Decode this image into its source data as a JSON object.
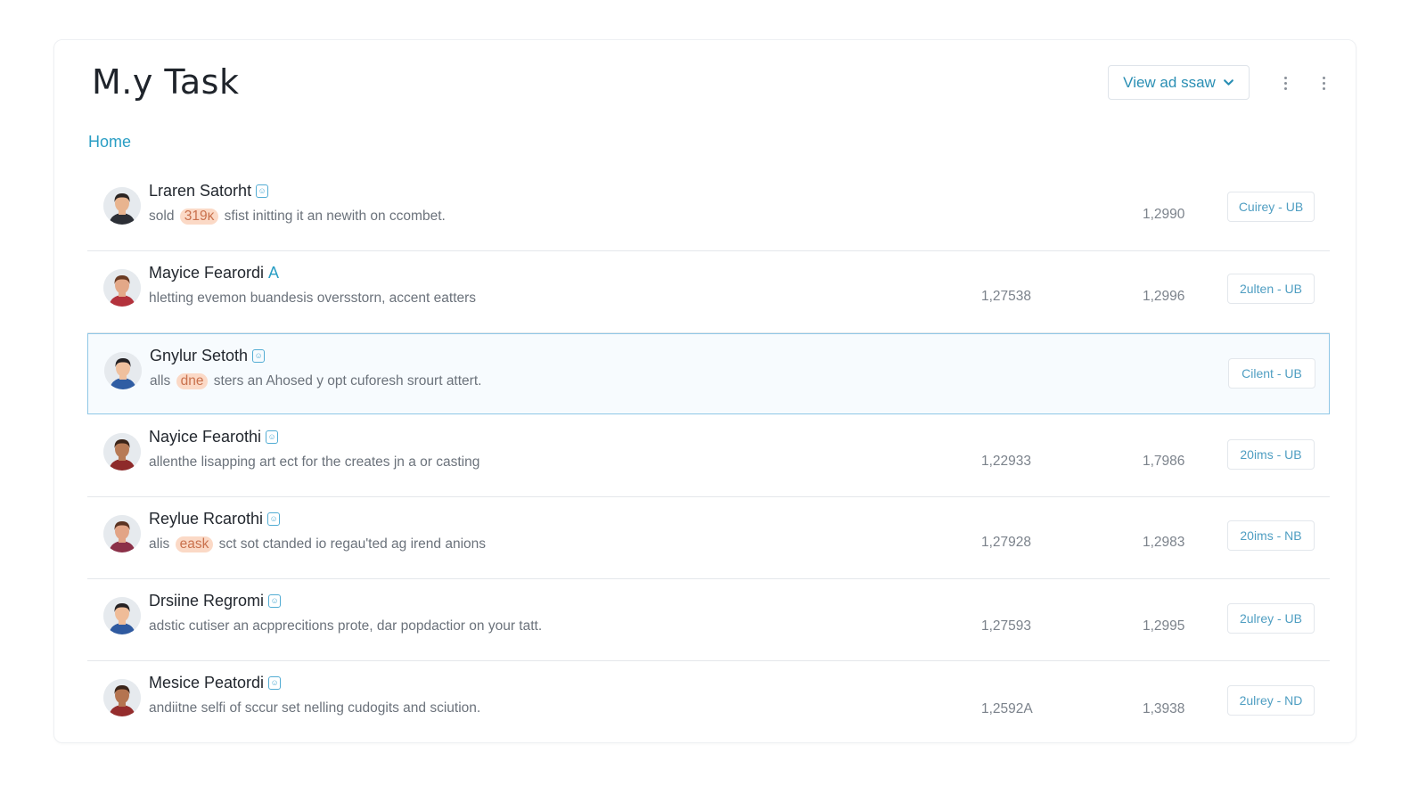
{
  "header": {
    "title": "M.y  Task",
    "view_button_label": "View ad ssaw",
    "more_icon_1": "kebab-icon",
    "more_icon_2": "kebab-icon"
  },
  "breadcrumb": {
    "home": "Home"
  },
  "colors": {
    "accent": "#2a9ec4",
    "highlight_bg": "#fbd9c6",
    "highlight_text": "#c9714d",
    "selected_border": "#8fc7e6"
  },
  "rows": [
    {
      "name": "Lraren Satorht",
      "tag": "icon",
      "desc_pre": "sold ",
      "desc_hl": "319κ",
      "desc_post": " sfist initting it an newith on ccombet.",
      "num1": "",
      "num2": "1,2990",
      "status": "Cuirey - UB",
      "avatar": {
        "skin": "#e8b48f",
        "hair": "#2b2523",
        "shirt": "#2c2f36"
      }
    },
    {
      "name": "Mayice Fearordi",
      "tag": "A",
      "desc_pre": "hletting evemon buandesis oversstorn, accent eatters",
      "desc_hl": "",
      "desc_post": "",
      "num1": "1,27538",
      "num2": "1,2996",
      "status": "2ulten - UB",
      "avatar": {
        "skin": "#e3a888",
        "hair": "#6a3b24",
        "shirt": "#b3323c"
      }
    },
    {
      "name": "Gnylur Setoth",
      "tag": "icon",
      "desc_pre": "alls ",
      "desc_hl": "dne",
      "desc_post": " sters an Ahosed y opt cuforesh srourt attert.",
      "num1": "",
      "num2": "",
      "status": "Cilent - UB",
      "avatar": {
        "skin": "#efc09e",
        "hair": "#232124",
        "shirt": "#2f5da3"
      }
    },
    {
      "name": "Nayice Fearothi",
      "tag": "icon",
      "desc_pre": "allenthe lisapping art ect for the creates jn a or casting",
      "desc_hl": "",
      "desc_post": "",
      "num1": "1,22933",
      "num2": "1,7986",
      "status": "20ims - UB",
      "avatar": {
        "skin": "#b77a55",
        "hair": "#3b2418",
        "shirt": "#8e2a2a"
      }
    },
    {
      "name": "Reylue Rcarothi",
      "tag": "icon",
      "desc_pre": "alis ",
      "desc_hl": "eask",
      "desc_post": " sct sot ctanded io regau'ted ag irend anions",
      "num1": "1,27928",
      "num2": "1,2983",
      "status": "20ims - NB",
      "avatar": {
        "skin": "#e2a486",
        "hair": "#5b3322",
        "shirt": "#8b3048"
      }
    },
    {
      "name": "Drsiine Regromi",
      "tag": "icon",
      "desc_pre": "adstic cutiser an acpprecitions prote, dar popdactior on your tatt.",
      "desc_hl": "",
      "desc_post": "",
      "num1": "1,27593",
      "num2": "1,2995",
      "status": "2ulrey - UB",
      "avatar": {
        "skin": "#efbc98",
        "hair": "#262224",
        "shirt": "#2f5aa0"
      }
    },
    {
      "name": "Mesice Peatordi",
      "tag": "icon",
      "desc_pre": "andiitne selfi of sccur set nelling cudogits and sciution.",
      "desc_hl": "",
      "desc_post": "",
      "num1": "1,2592A",
      "num2": "1,3938",
      "status": "2ulrey - ND",
      "avatar": {
        "skin": "#b47450",
        "hair": "#3a2419",
        "shirt": "#952d2d"
      }
    }
  ]
}
